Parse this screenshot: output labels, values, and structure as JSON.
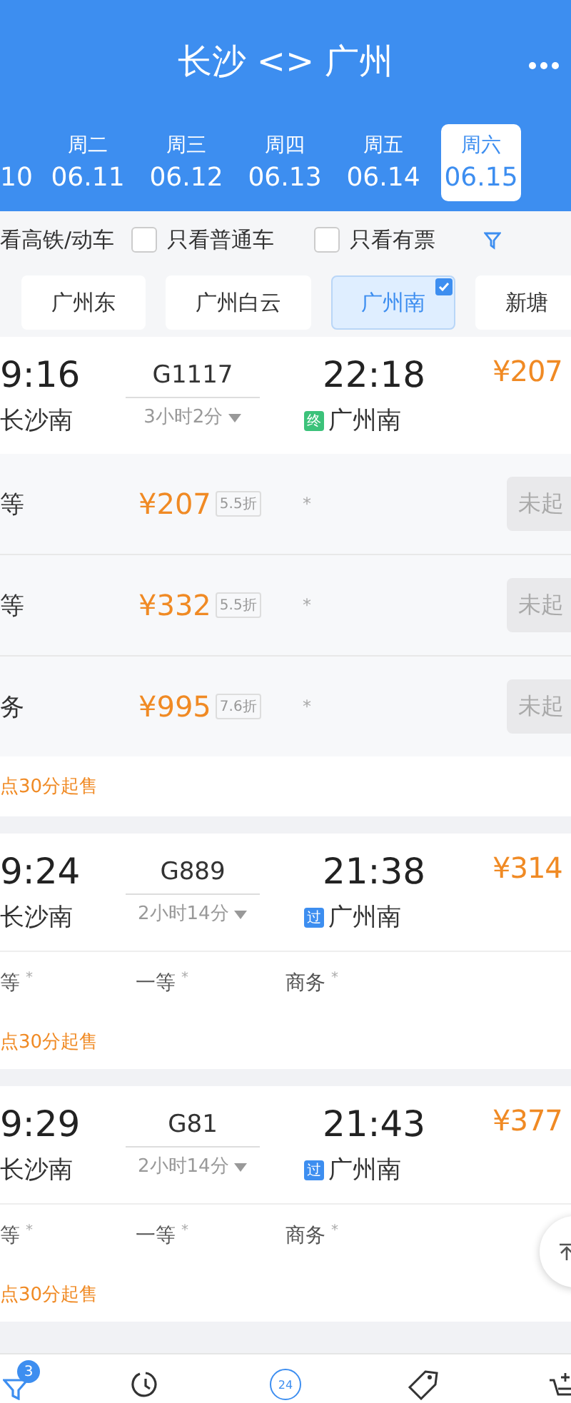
{
  "header": {
    "title": "长沙 <> 广州"
  },
  "dates": [
    {
      "date": "10",
      "selected": false
    },
    {
      "weekday": "周二",
      "date": "06.11",
      "selected": false
    },
    {
      "weekday": "周三",
      "date": "06.12",
      "selected": false
    },
    {
      "weekday": "周四",
      "date": "06.13",
      "selected": false
    },
    {
      "weekday": "周五",
      "date": "06.14",
      "selected": false
    },
    {
      "weekday": "周六",
      "date": "06.15",
      "selected": true
    }
  ],
  "filters": [
    {
      "kind": "text",
      "label": "看高铁/动车"
    },
    {
      "kind": "checkbox",
      "label": "只看普通车",
      "checked": false
    },
    {
      "kind": "checkbox",
      "label": "只看有票",
      "checked": false
    }
  ],
  "stations": [
    {
      "label": "广州东",
      "selected": false
    },
    {
      "label": "广州白云",
      "selected": false
    },
    {
      "label": "广州南",
      "selected": true
    },
    {
      "label": "新塘",
      "selected": false
    }
  ],
  "trains": [
    {
      "depart_time": "9:16",
      "depart_station": "长沙南",
      "number": "G1117",
      "duration": "3小时2分",
      "arrive_time": "22:18",
      "arrive_tag": {
        "label": "终",
        "color": "#3cc27a"
      },
      "arrive_station": "广州南",
      "price": "¥207",
      "expanded": true,
      "seats": [
        {
          "name": "等",
          "price": "¥207",
          "discount": "5.5折",
          "availability": "*",
          "action": "未起"
        },
        {
          "name": "等",
          "price": "¥332",
          "discount": "5.5折",
          "availability": "*",
          "action": "未起"
        },
        {
          "name": "务",
          "price": "¥995",
          "discount": "7.6折",
          "availability": "*",
          "action": "未起"
        }
      ],
      "sale_note": "点30分起售"
    },
    {
      "depart_time": "9:24",
      "depart_station": "长沙南",
      "number": "G889",
      "duration": "2小时14分",
      "arrive_time": "21:38",
      "arrive_tag": {
        "label": "过",
        "color": "#3d8ef0"
      },
      "arrive_station": "广州南",
      "price": "¥314",
      "expanded": false,
      "seats": [
        {
          "name": "等",
          "availability": "*"
        },
        {
          "name": "一等",
          "availability": "*"
        },
        {
          "name": "商务",
          "availability": "*"
        }
      ],
      "sale_note": "点30分起售"
    },
    {
      "depart_time": "9:29",
      "depart_station": "长沙南",
      "number": "G81",
      "duration": "2小时14分",
      "arrive_time": "21:43",
      "arrive_tag": {
        "label": "过",
        "color": "#3d8ef0"
      },
      "arrive_station": "广州南",
      "price": "¥377",
      "expanded": false,
      "seats": [
        {
          "name": "等",
          "availability": "*"
        },
        {
          "name": "一等",
          "availability": "*"
        },
        {
          "name": "商务",
          "availability": "*"
        }
      ],
      "sale_note": "点30分起售"
    }
  ],
  "bottom_nav": {
    "badge": "3",
    "calendar_day": "24"
  }
}
